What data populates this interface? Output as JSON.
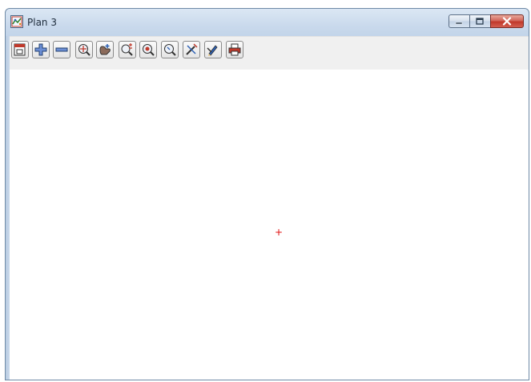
{
  "window": {
    "title": "Plan 3",
    "app_icon": "plan-view-icon"
  },
  "caption_buttons": [
    {
      "name": "minimize-button",
      "icon": "minimize-icon"
    },
    {
      "name": "maximize-button",
      "icon": "maximize-icon"
    },
    {
      "name": "close-button",
      "icon": "close-icon"
    }
  ],
  "toolbar": {
    "buttons": [
      {
        "name": "redraw-button",
        "icon": "redraw-icon"
      },
      {
        "name": "zoom-in-button",
        "icon": "plus-icon"
      },
      {
        "name": "zoom-out-button",
        "icon": "minus-icon"
      },
      {
        "name": "zoom-extents-button",
        "icon": "zoom-target-icon"
      },
      {
        "name": "pan-button",
        "icon": "pan-hand-icon"
      },
      {
        "name": "zoom-window-button",
        "icon": "zoom-plus-minus-icon"
      },
      {
        "name": "zoom-centre-button",
        "icon": "zoom-centre-icon"
      },
      {
        "name": "zoom-previous-button",
        "icon": "magnifier-icon"
      },
      {
        "name": "select-button",
        "icon": "wand-cross-icon"
      },
      {
        "name": "cursor-button",
        "icon": "pencil-icon"
      },
      {
        "name": "print-button",
        "icon": "printer-icon"
      }
    ]
  },
  "canvas": {
    "cursor_glyph": "+",
    "cursor_color": "#e01010"
  },
  "colors": {
    "title_bar": "#c9d9ec",
    "close_button": "#c1392b",
    "toolbar": "#f0f0f0",
    "canvas": "#ffffff"
  }
}
